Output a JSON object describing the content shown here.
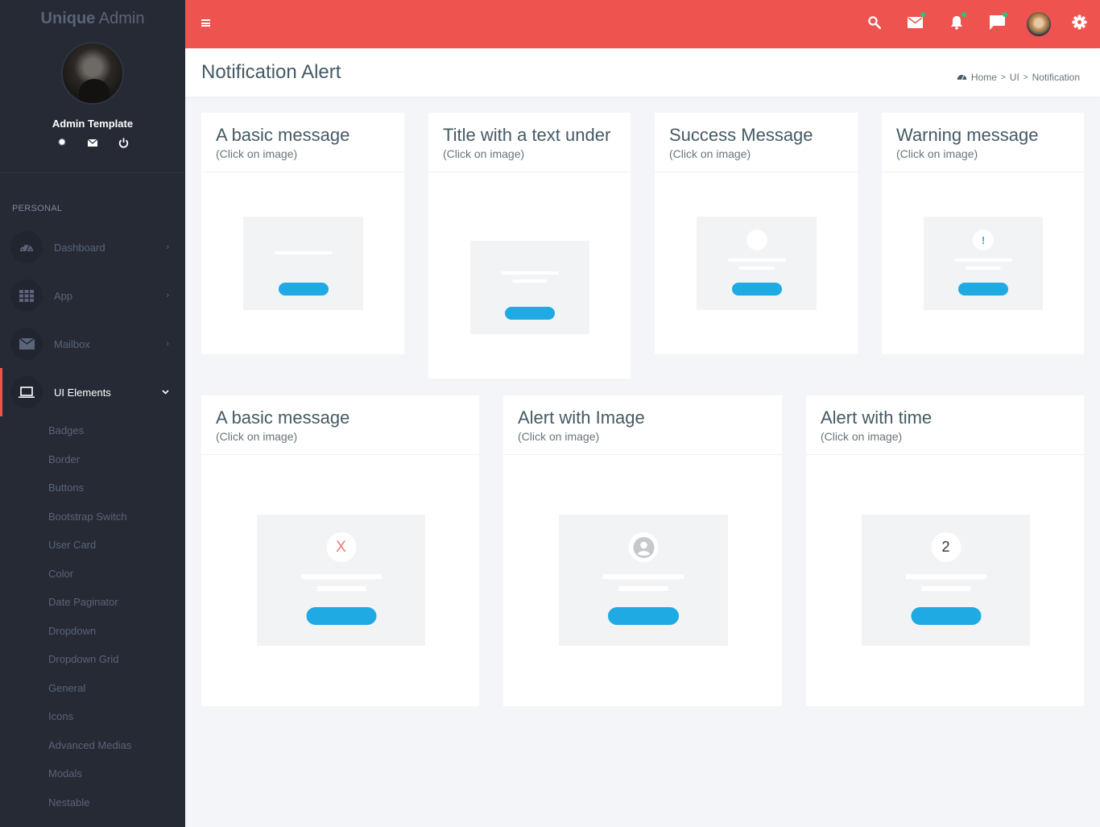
{
  "brand": {
    "bold": "Unique",
    "light": " Admin"
  },
  "profile": {
    "name": "Admin Template"
  },
  "sidebar": {
    "section_header": "PERSONAL",
    "items": [
      {
        "label": "Dashboard",
        "icon": "dashboard-icon",
        "chevron": "›"
      },
      {
        "label": "App",
        "icon": "grid-icon",
        "chevron": "›"
      },
      {
        "label": "Mailbox",
        "icon": "mail-icon",
        "chevron": "›"
      },
      {
        "label": "UI Elements",
        "icon": "laptop-icon",
        "chevron": "⌄",
        "active": true
      }
    ],
    "subitems": [
      "Badges",
      "Border",
      "Buttons",
      "Bootstrap Switch",
      "User Card",
      "Color",
      "Date Paginator",
      "Dropdown",
      "Dropdown Grid",
      "General",
      "Icons",
      "Advanced Medias",
      "Modals",
      "Nestable"
    ]
  },
  "topbar": {
    "icons": [
      "search-icon",
      "mail-icon",
      "bell-icon",
      "chat-icon",
      "user-avatar",
      "gear-icon"
    ],
    "accent": "#ef5350",
    "notification_dot_color": "#26c281"
  },
  "page": {
    "title": "Notification Alert",
    "breadcrumb": [
      "Home",
      "UI",
      "Notification"
    ]
  },
  "cards": [
    {
      "title": "A basic message",
      "subtitle": "(Click on image)"
    },
    {
      "title": "Title with a text under",
      "subtitle": "(Click on image)"
    },
    {
      "title": "Success Message",
      "subtitle": "(Click on image)"
    },
    {
      "title": "Warning message",
      "subtitle": "(Click on image)"
    },
    {
      "title": "A basic message",
      "subtitle": "(Click on image)",
      "badge": "X"
    },
    {
      "title": "Alert with Image",
      "subtitle": "(Click on image)"
    },
    {
      "title": "Alert with time",
      "subtitle": "(Click on image)",
      "badge": "2"
    }
  ],
  "colors": {
    "button_blue": "#20aae3",
    "error_red": "#f27474",
    "warning_blue": "#3fa7d6"
  }
}
